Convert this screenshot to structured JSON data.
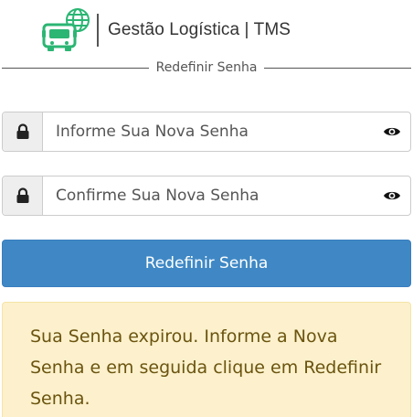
{
  "header": {
    "title": "Gestão Logística | TMS",
    "logo_icon": "truck-globe-icon"
  },
  "divider": {
    "label": "Redefinir Senha"
  },
  "form": {
    "new_password": {
      "placeholder": "Informe Sua Nova Senha",
      "value": "",
      "lock_icon": "lock-icon",
      "toggle_icon": "eye-icon"
    },
    "confirm_password": {
      "placeholder": "Confirme Sua Nova Senha",
      "value": "",
      "lock_icon": "lock-icon",
      "toggle_icon": "eye-icon"
    },
    "submit_label": "Redefinir Senha"
  },
  "alert": {
    "message": "Sua Senha expirou. Informe a Nova Senha e em seguida clique em Redefinir Senha."
  },
  "colors": {
    "primary_button": "#3f88c5",
    "logo_green": "#2bb673",
    "alert_background": "#fcf1cc",
    "alert_text": "#6b5410"
  }
}
